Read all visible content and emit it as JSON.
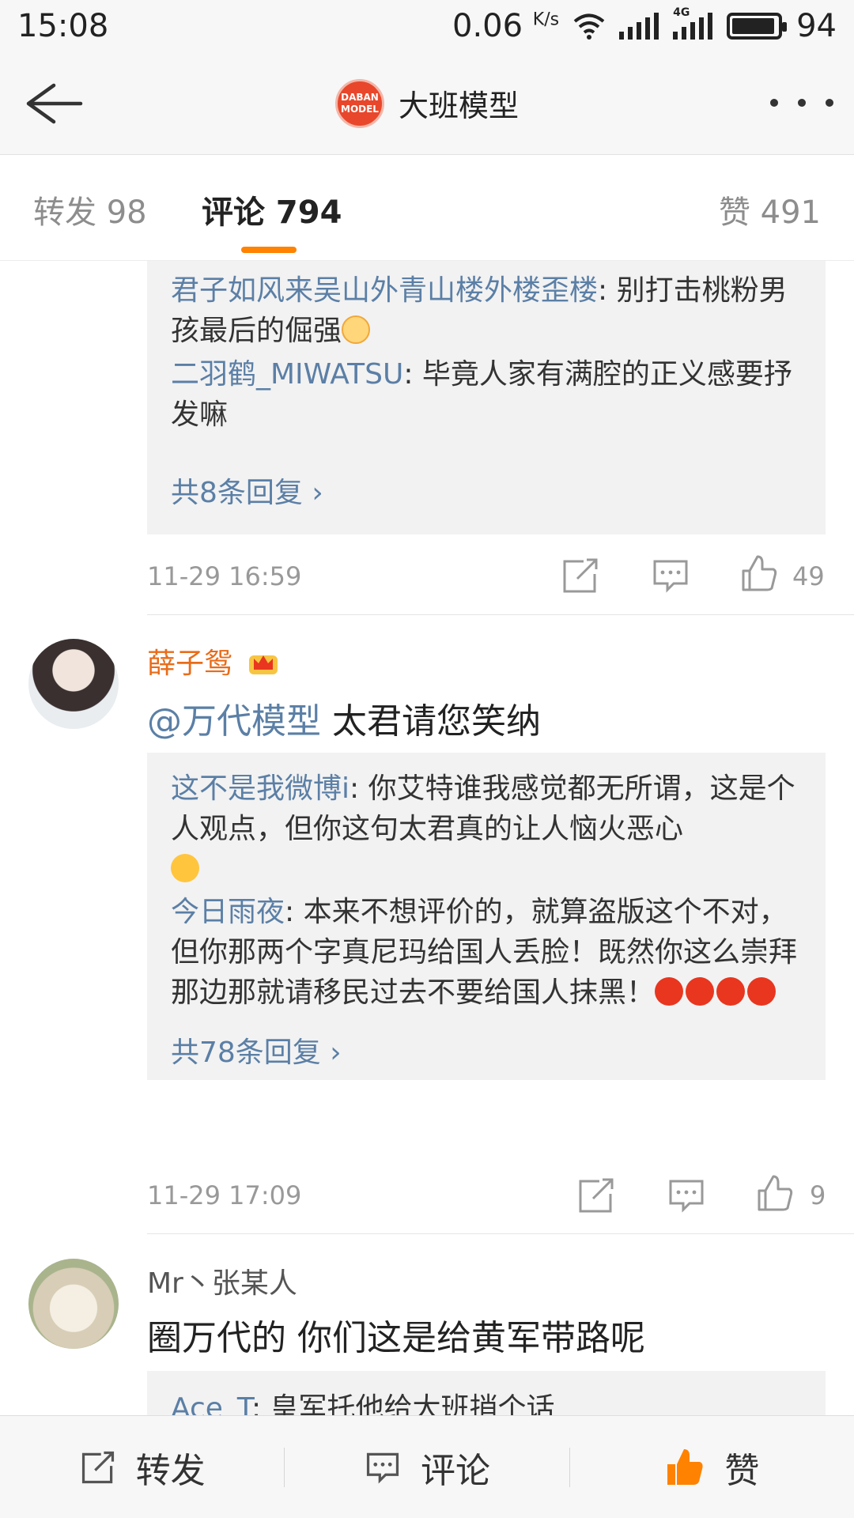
{
  "status_bar": {
    "time": "15:08",
    "speed": "0.06",
    "speed_unit": "K/s",
    "network": "4G",
    "battery": "94"
  },
  "nav": {
    "title": "大班模型",
    "logo_line1": "DABAN",
    "logo_line2": "MODEL"
  },
  "tabs": {
    "repost": "转发 98",
    "comment": "评论 794",
    "like": "赞 491"
  },
  "comments": [
    {
      "replies": [
        {
          "name": "君子如风来吴山外青山楼外楼歪楼",
          "text": ": 别打击桃粉男孩最后的倔强"
        },
        {
          "name": "二羽鹤_MIWATSU",
          "text": ": 毕竟人家有满腔的正义感要抒发嘛"
        }
      ],
      "more_replies": "共8条回复 ›",
      "time": "11-29 16:59",
      "likes": "49"
    },
    {
      "user": "薛子鸳",
      "mention": "@万代模型",
      "text": " 太君请您笑纳",
      "replies": [
        {
          "name": "这不是我微博i",
          "text": ": 你艾特谁我感觉都无所谓，这是个人观点，但你这句太君真的让人恼火恶心"
        },
        {
          "name": "今日雨夜",
          "text": ": 本来不想评价的，就算盗版这个不对，但你那两个字真尼玛给国人丢脸！既然你这么崇拜那边那就请移民过去不要给国人抹黑！"
        }
      ],
      "more_replies": "共78条回复 ›",
      "time": "11-29 17:09",
      "likes": "9"
    },
    {
      "user": "Mr丶张某人",
      "text": "圈万代的  你们这是给黄军带路呢",
      "replies": [
        {
          "name": "Ace_T",
          "text": ": 皇军托他给大班捎个话"
        }
      ]
    }
  ],
  "toolbar": {
    "repost": "转发",
    "comment": "评论",
    "like": "赞"
  },
  "colors": {
    "accent": "#ff8200",
    "link": "#5b7fa6",
    "username_vip": "#e86c1a"
  }
}
